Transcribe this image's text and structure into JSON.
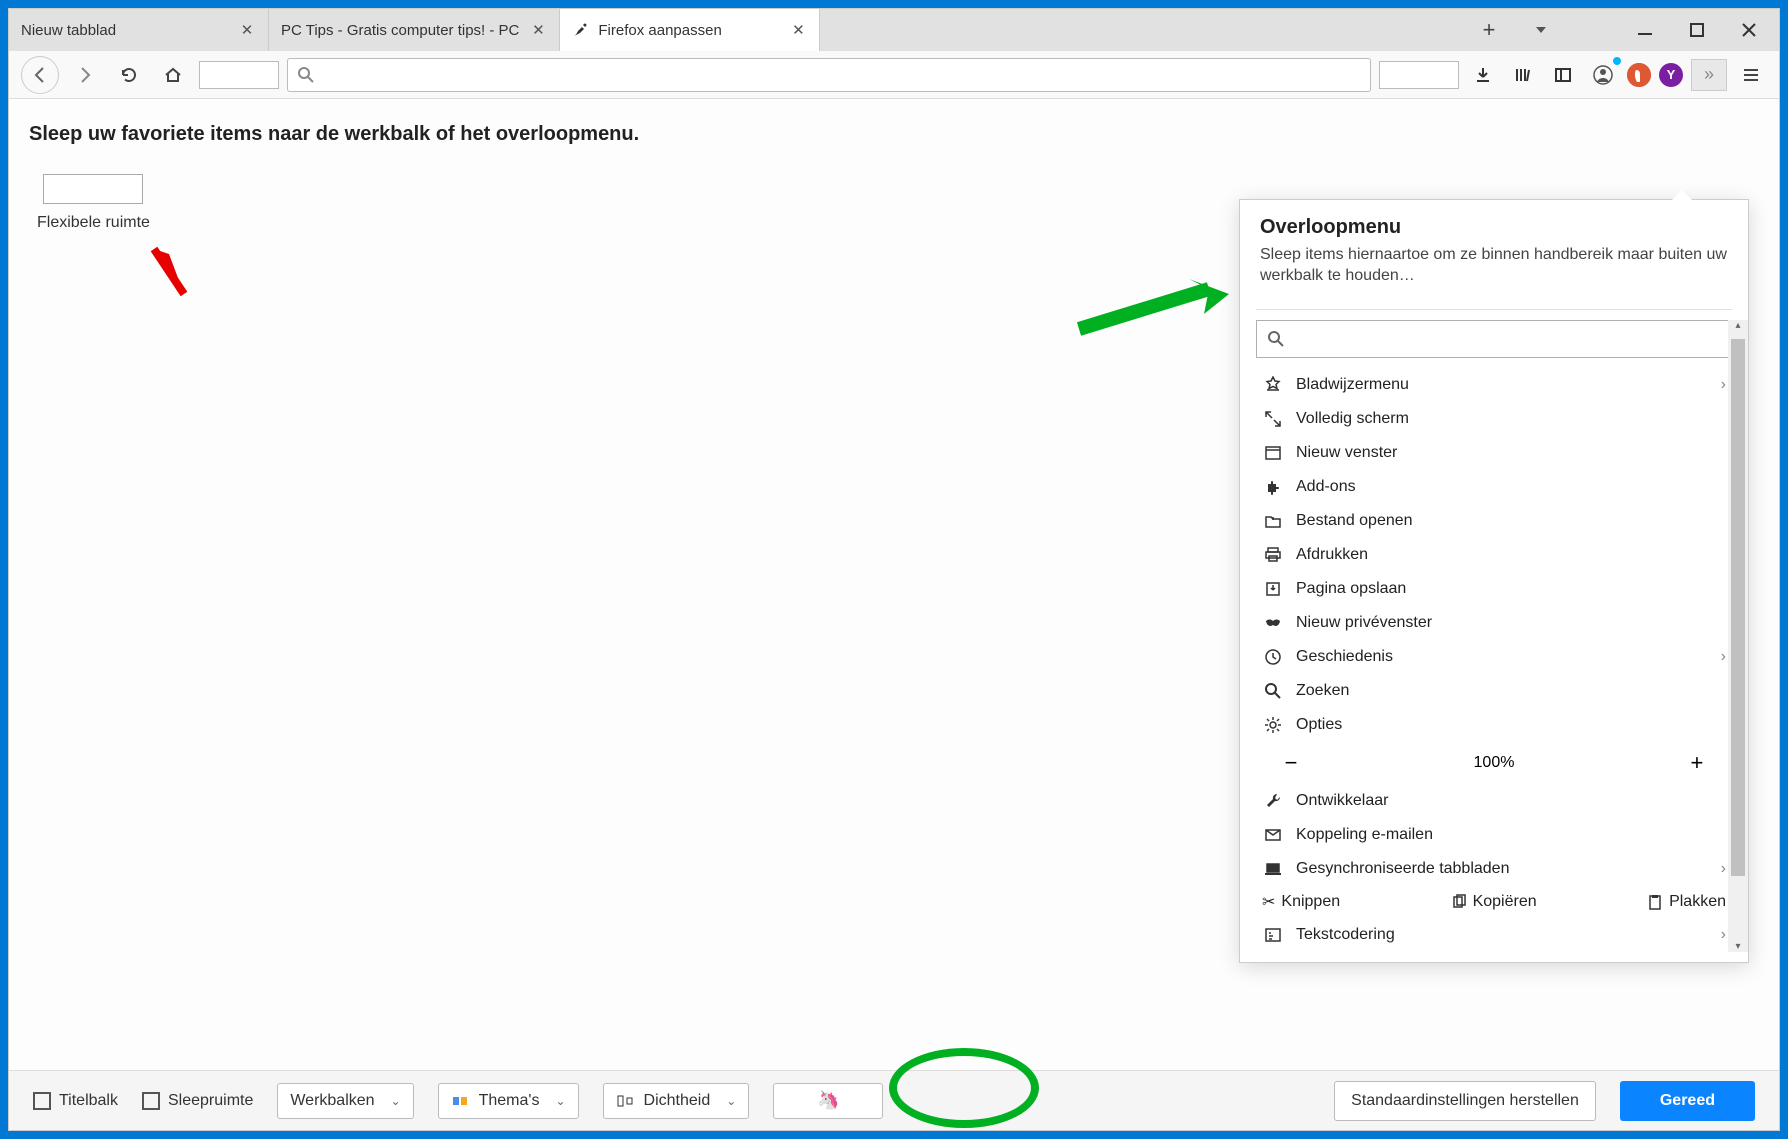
{
  "tabs": [
    {
      "label": "Nieuw tabblad"
    },
    {
      "label": "PC Tips - Gratis computer tips! - PC"
    },
    {
      "label": "Firefox aanpassen"
    }
  ],
  "instruction": "Sleep uw favoriete items naar de werkbalk of het overloopmenu.",
  "flexible_space_label": "Flexibele ruimte",
  "overflow": {
    "title": "Overloopmenu",
    "desc": "Sleep items hiernaartoe om ze binnen handbereik maar buiten uw werkbalk te houden…",
    "items": {
      "bookmarks": "Bladwijzermenu",
      "fullscreen": "Volledig scherm",
      "new_window": "Nieuw venster",
      "addons": "Add-ons",
      "open_file": "Bestand openen",
      "print": "Afdrukken",
      "save_page": "Pagina opslaan",
      "private": "Nieuw privévenster",
      "history": "Geschiedenis",
      "search": "Zoeken",
      "options": "Opties",
      "zoom_value": "100%",
      "developer": "Ontwikkelaar",
      "email_link": "Koppeling e-mailen",
      "synced_tabs": "Gesynchroniseerde tabbladen",
      "cut": "Knippen",
      "copy": "Kopiëren",
      "paste": "Plakken",
      "encoding": "Tekstcodering"
    }
  },
  "footer": {
    "titlebar": "Titelbalk",
    "dragspace": "Sleepruimte",
    "toolbars": "Werkbalken",
    "themes": "Thema's",
    "density": "Dichtheid",
    "restore": "Standaardinstellingen herstellen",
    "done": "Gereed"
  }
}
